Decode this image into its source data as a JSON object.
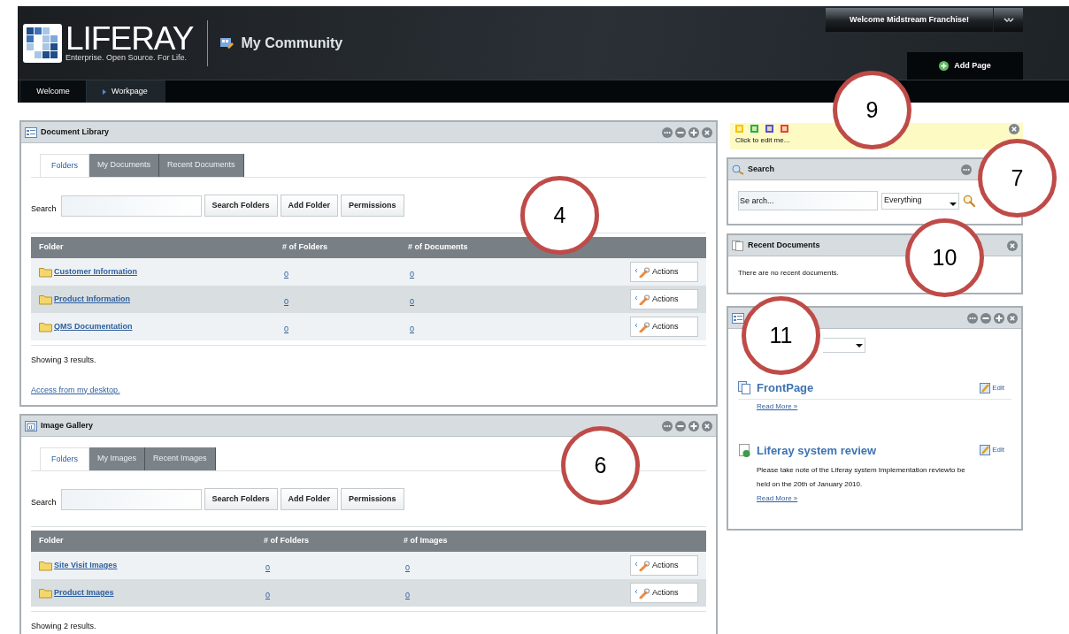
{
  "header": {
    "logo_word": "LIFERAY",
    "logo_tagline": "Enterprise. Open Source. For Life.",
    "community": "My Community",
    "user_menu": "Welcome Midstream Franchise!",
    "add_page": "Add Page"
  },
  "nav_tabs": [
    {
      "label": "Welcome",
      "selected": false
    },
    {
      "label": "Workpage",
      "selected": true
    }
  ],
  "left_portlets": [
    {
      "title": "Document Library",
      "controls": [
        {
          "kind": "options"
        },
        {
          "kind": "minimize"
        },
        {
          "kind": "maximize"
        },
        {
          "kind": "close"
        }
      ],
      "tabs": [
        {
          "label": "Folders",
          "selected": true
        },
        {
          "label": "My Documents",
          "selected": false
        },
        {
          "label": "Recent Documents",
          "selected": false
        }
      ],
      "search_label": "Search",
      "buttons": [
        "Search Folders",
        "Add Folder",
        "Permissions"
      ],
      "columns": [
        "Folder",
        "# of Folders",
        "# of Documents"
      ],
      "rows": [
        {
          "cells": [
            "Customer Information",
            "0",
            "0"
          ],
          "action": "Actions"
        },
        {
          "cells": [
            "Product Information",
            "0",
            "0"
          ],
          "action": "Actions"
        },
        {
          "cells": [
            "QMS Documentation",
            "0",
            "0"
          ],
          "action": "Actions"
        }
      ],
      "result_text": "Showing 3 results.",
      "link": "Access from my desktop.",
      "callout": "4"
    },
    {
      "title": "Image Gallery",
      "controls": [
        {
          "kind": "options"
        },
        {
          "kind": "minimize"
        },
        {
          "kind": "maximize"
        },
        {
          "kind": "close"
        }
      ],
      "tabs": [
        {
          "label": "Folders",
          "selected": true
        },
        {
          "label": "My Images",
          "selected": false
        },
        {
          "label": "Recent Images",
          "selected": false
        }
      ],
      "search_label": "Search",
      "buttons": [
        "Search Folders",
        "Add Folder",
        "Permissions"
      ],
      "columns": [
        "Folder",
        "# of Folders",
        "# of Images"
      ],
      "rows": [
        {
          "cells": [
            "Site Visit Images",
            "0",
            "0"
          ],
          "action": "Actions"
        },
        {
          "cells": [
            "Product Images",
            "0",
            "0"
          ],
          "action": "Actions"
        }
      ],
      "result_text": "Showing 2 results.",
      "callout": "6"
    }
  ],
  "note": {
    "colors": [
      {
        "color": "#f5c400"
      },
      {
        "color": "#22b14c"
      },
      {
        "color": "#5a4fcf"
      },
      {
        "color": "#e8413c"
      }
    ],
    "text": "Click to edit me...",
    "callout": "9"
  },
  "search_portlet": {
    "title": "Search",
    "controls": [
      {
        "kind": "options"
      }
    ],
    "value": "Se arch...",
    "scope": "Everything",
    "callout": "7"
  },
  "recent_portlet": {
    "title": "Recent Documents",
    "controls": [
      {
        "kind": "close"
      }
    ],
    "message": "There are no recent documents.",
    "callout": "10"
  },
  "asset_portlet": {
    "controls": [
      {
        "kind": "options"
      },
      {
        "kind": "minimize"
      },
      {
        "kind": "maximize"
      },
      {
        "kind": "close"
      }
    ],
    "callout": "11",
    "entries": [
      {
        "kind": "page",
        "title": "FrontPage",
        "edit": "Edit",
        "more": "Read More »"
      },
      {
        "kind": "article",
        "title": "Liferay system review",
        "edit": "Edit",
        "summary": "Please take note of the Liferay system  Implementation reviewto be held on the 20th of January 2010.",
        "more": "Read More »"
      }
    ]
  }
}
